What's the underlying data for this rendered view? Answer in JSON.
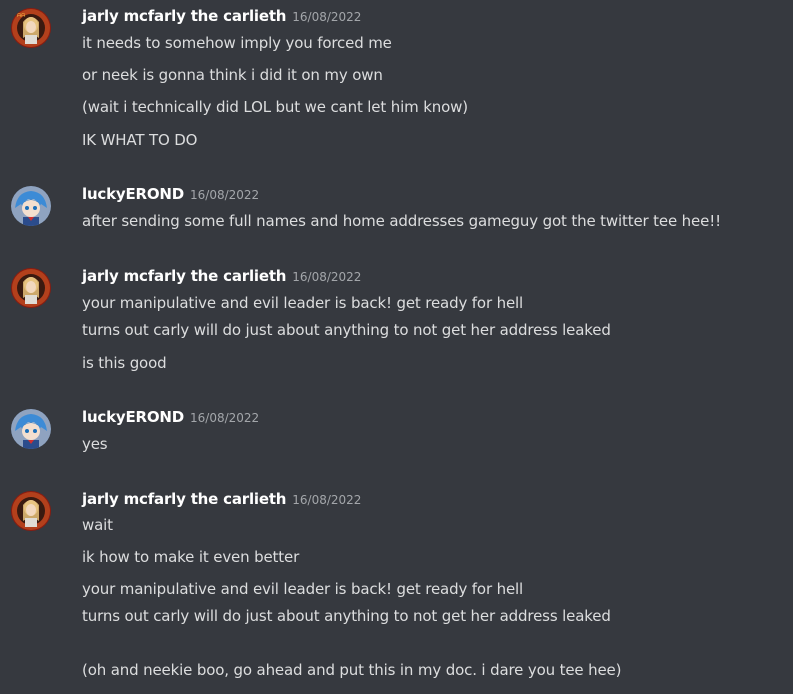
{
  "messages": [
    {
      "author": "jarly mcfarly the carlieth",
      "timestamp": "16/08/2022",
      "avatar_icon": "anime-character-avatar-icon",
      "lines": [
        "it needs to somehow imply you forced me",
        "or neek is gonna think i did it on my own",
        "(wait i technically did LOL but we cant let him know)",
        "IK WHAT TO DO"
      ]
    },
    {
      "author": "luckyEROND",
      "timestamp": "16/08/2022",
      "avatar_icon": "blue-hair-character-avatar-icon",
      "lines": [
        "after sending some full names and home addresses gameguy got the twitter tee hee!!"
      ]
    },
    {
      "author": "jarly mcfarly the carlieth",
      "timestamp": "16/08/2022",
      "avatar_icon": "anime-character-avatar-icon",
      "lines": [
        "your manipulative and evil leader is back! get ready for hell",
        "turns out carly will do just about anything to not get her address leaked",
        "is this good"
      ]
    },
    {
      "author": "luckyEROND",
      "timestamp": "16/08/2022",
      "avatar_icon": "blue-hair-character-avatar-icon",
      "lines": [
        "yes"
      ]
    },
    {
      "author": "jarly mcfarly the carlieth",
      "timestamp": "16/08/2022",
      "avatar_icon": "anime-character-avatar-icon",
      "lines": [
        "wait",
        "ik how to make it even better",
        "your manipulative and evil leader is back! get ready for hell",
        "turns out carly will do just about anything to not get her address leaked",
        "(oh and neekie boo, go ahead and put this in my doc. i dare you tee hee)"
      ]
    }
  ],
  "colors": {
    "background": "#36393f",
    "username": "#ffffff",
    "timestamp": "#a3a6aa",
    "message_text": "#dcddde"
  }
}
